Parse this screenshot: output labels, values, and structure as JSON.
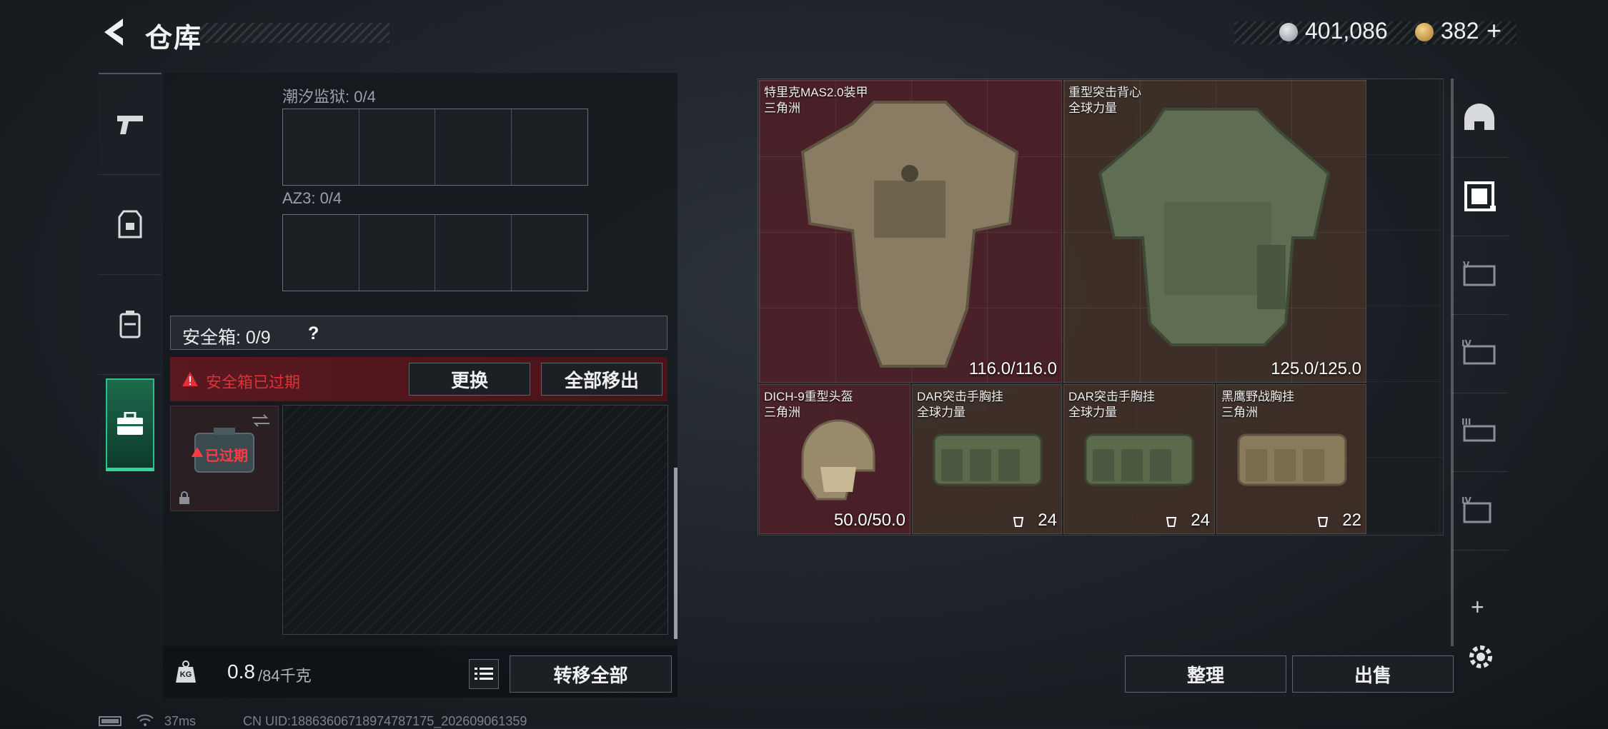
{
  "header": {
    "title": "仓库"
  },
  "currency": {
    "silver": "401,086",
    "gold": "382",
    "gold_add": "+"
  },
  "left_nav": {
    "items": [
      {
        "name": "weapons-tab",
        "icon": "pistol-icon"
      },
      {
        "name": "armor-tab",
        "icon": "vest-icon"
      },
      {
        "name": "backpack-tab",
        "icon": "backpack-icon"
      },
      {
        "name": "safe-box-tab",
        "icon": "briefcase-icon",
        "active": true
      }
    ]
  },
  "storage": {
    "slot1_label": "潮汐监狱: 0/4",
    "slot2_label": "AZ3: 0/4",
    "safe_label": "安全箱: 0/9",
    "safe_help": "?",
    "expired_warning": "安全箱已过期",
    "replace_button": "更换",
    "remove_all_button": "全部移出",
    "case_expired_badge": "已过期",
    "weight_current": "0.8",
    "weight_max": "/84千克",
    "weight_icon_label": "KG",
    "transfer_all_button": "转移全部"
  },
  "items": [
    {
      "name": "特里克MAS2.0装甲",
      "origin": "三角洲",
      "value": "116.0/116.0",
      "bg": "#562028"
    },
    {
      "name": "重型突击背心",
      "origin": "全球力量",
      "value": "125.0/125.0",
      "bg": "#483428"
    },
    {
      "name": "DICH-9重型头盔",
      "origin": "三角洲",
      "value": "50.0/50.0",
      "bg": "#562028"
    },
    {
      "name": "DAR突击手胸挂",
      "origin": "全球力量",
      "value": "24",
      "bg": "#483428"
    },
    {
      "name": "DAR突击手胸挂",
      "origin": "全球力量",
      "value": "24",
      "bg": "#483428"
    },
    {
      "name": "黑鹰野战胸挂",
      "origin": "三角洲",
      "value": "22",
      "bg": "#483428"
    }
  ],
  "right_nav": {
    "items": [
      {
        "name": "helmet-slot",
        "icon": "helmet-icon"
      },
      {
        "name": "armor-slot",
        "icon": "armor-icon",
        "active": true
      },
      {
        "name": "rig-v-slot",
        "icon": "rig-icon",
        "tier": "V"
      },
      {
        "name": "rig-iv-slot",
        "icon": "rig-icon",
        "tier": "IV"
      },
      {
        "name": "rig-iii-slot",
        "icon": "rig-icon",
        "tier": "III"
      },
      {
        "name": "rig-iv2-slot",
        "icon": "rig-icon",
        "tier": "IV"
      }
    ],
    "add_label": "+"
  },
  "actions": {
    "sort_button": "整理",
    "sell_button": "出售"
  },
  "status_bar": {
    "ping": "37ms",
    "uid": "CN UID:18863606718974787175_202609061359"
  },
  "colors": {
    "accent_green": "#33d69a",
    "warning_red": "#e0303a",
    "armor_bg": "#562028",
    "rig_bg": "#483428"
  }
}
